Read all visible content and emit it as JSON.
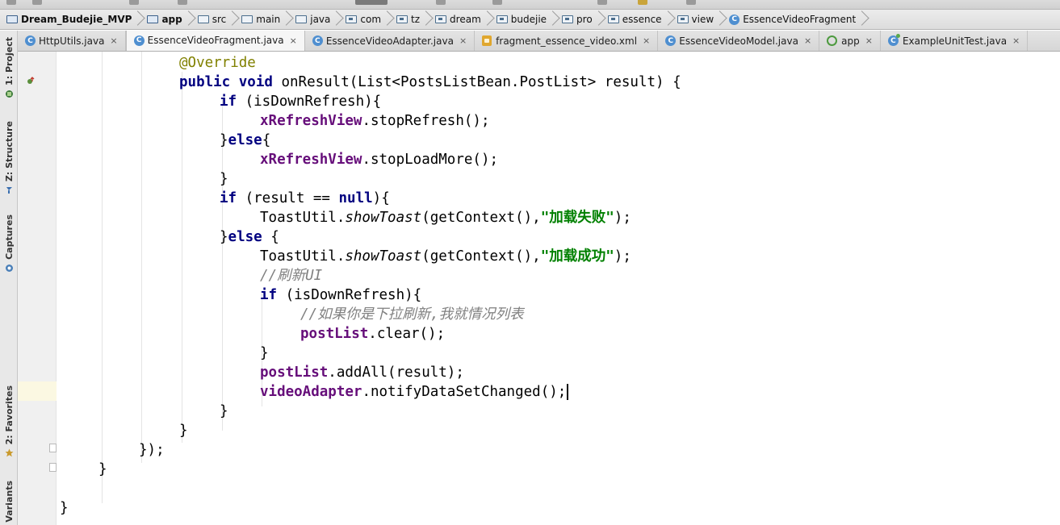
{
  "breadcrumb": [
    {
      "label": "Dream_Budejie_MVP",
      "icon": "project-folder-icon",
      "bold": true
    },
    {
      "label": "app",
      "icon": "module-folder-icon",
      "bold": true
    },
    {
      "label": "src",
      "icon": "folder-icon"
    },
    {
      "label": "main",
      "icon": "folder-icon"
    },
    {
      "label": "java",
      "icon": "source-folder-icon"
    },
    {
      "label": "com",
      "icon": "package-icon"
    },
    {
      "label": "tz",
      "icon": "package-icon"
    },
    {
      "label": "dream",
      "icon": "package-icon"
    },
    {
      "label": "budejie",
      "icon": "package-icon"
    },
    {
      "label": "pro",
      "icon": "package-icon"
    },
    {
      "label": "essence",
      "icon": "package-icon"
    },
    {
      "label": "view",
      "icon": "package-icon"
    },
    {
      "label": "EssenceVideoFragment",
      "icon": "class-icon"
    }
  ],
  "tabs": [
    {
      "label": "HttpUtils.java",
      "close": "×",
      "active": false,
      "icon": "class-icon"
    },
    {
      "label": "EssenceVideoFragment.java",
      "close": "×",
      "active": true,
      "icon": "class-icon"
    },
    {
      "label": "EssenceVideoAdapter.java",
      "close": "×",
      "active": false,
      "icon": "class-icon"
    },
    {
      "label": "fragment_essence_video.xml",
      "close": "×",
      "active": false,
      "icon": "xml-file-icon"
    },
    {
      "label": "EssenceVideoModel.java",
      "close": "×",
      "active": false,
      "icon": "class-icon"
    },
    {
      "label": "app",
      "close": "×",
      "active": false,
      "icon": "android-app-icon"
    },
    {
      "label": "ExampleUnitTest.java",
      "close": "×",
      "active": false,
      "icon": "test-class-icon"
    }
  ],
  "tool_windows": {
    "project": "1: Project",
    "structure": "Z: Structure",
    "captures": "Captures",
    "favorites": "2: Favorites",
    "variants": "d Variants"
  },
  "icons": {
    "class": "C",
    "test": "C"
  },
  "code": {
    "l01": {
      "a": "@Override"
    },
    "l02": {
      "k1": "public",
      "k2": "void",
      "t": " onResult(List<PostsListBean.PostList> result) {"
    },
    "l03": {
      "k": "if",
      "t": " (isDownRefresh){"
    },
    "l04": {
      "f": "xRefreshView",
      "t": ".stopRefresh();"
    },
    "l05": {
      "t1": "}",
      "k": "else",
      "t2": "{"
    },
    "l06": {
      "f": "xRefreshView",
      "t": ".stopLoadMore();"
    },
    "l07": {
      "t": "}"
    },
    "l08": {
      "k": "if",
      "t1": " (result == ",
      "k2": "null",
      "t2": "){"
    },
    "l09": {
      "t1": "ToastUtil.",
      "i": "showToast",
      "t2": "(getContext(),",
      "s": "\"加载失败\"",
      "t3": ");"
    },
    "l10": {
      "t1": "}",
      "k": "else",
      "t2": " {"
    },
    "l11": {
      "t1": "ToastUtil.",
      "i": "showToast",
      "t2": "(getContext(),",
      "s": "\"加载成功\"",
      "t3": ");"
    },
    "l12": {
      "c1": "//刷新",
      "c2": "UI"
    },
    "l13": {
      "k": "if",
      "t": " (isDownRefresh){"
    },
    "l14": {
      "c": "//如果你是下拉刷新,我就情况列表"
    },
    "l15": {
      "f": "postList",
      "t": ".clear();"
    },
    "l16": {
      "t": "}"
    },
    "l17": {
      "f": "postList",
      "t": ".addAll(result);"
    },
    "l18": {
      "f": "videoAdapter",
      "t": ".notifyDataSetChanged();"
    },
    "l19": {
      "t": "}"
    },
    "l20": {
      "t": "}"
    },
    "l21": {
      "t": "});"
    },
    "l22": {
      "t": "}"
    },
    "l23": {
      "t": "}"
    }
  },
  "colors": {
    "keyword": "#000080",
    "annotation": "#808000",
    "field": "#660e7a",
    "string": "#008000",
    "comment": "#808080",
    "current_line": "#fbf8e2"
  }
}
